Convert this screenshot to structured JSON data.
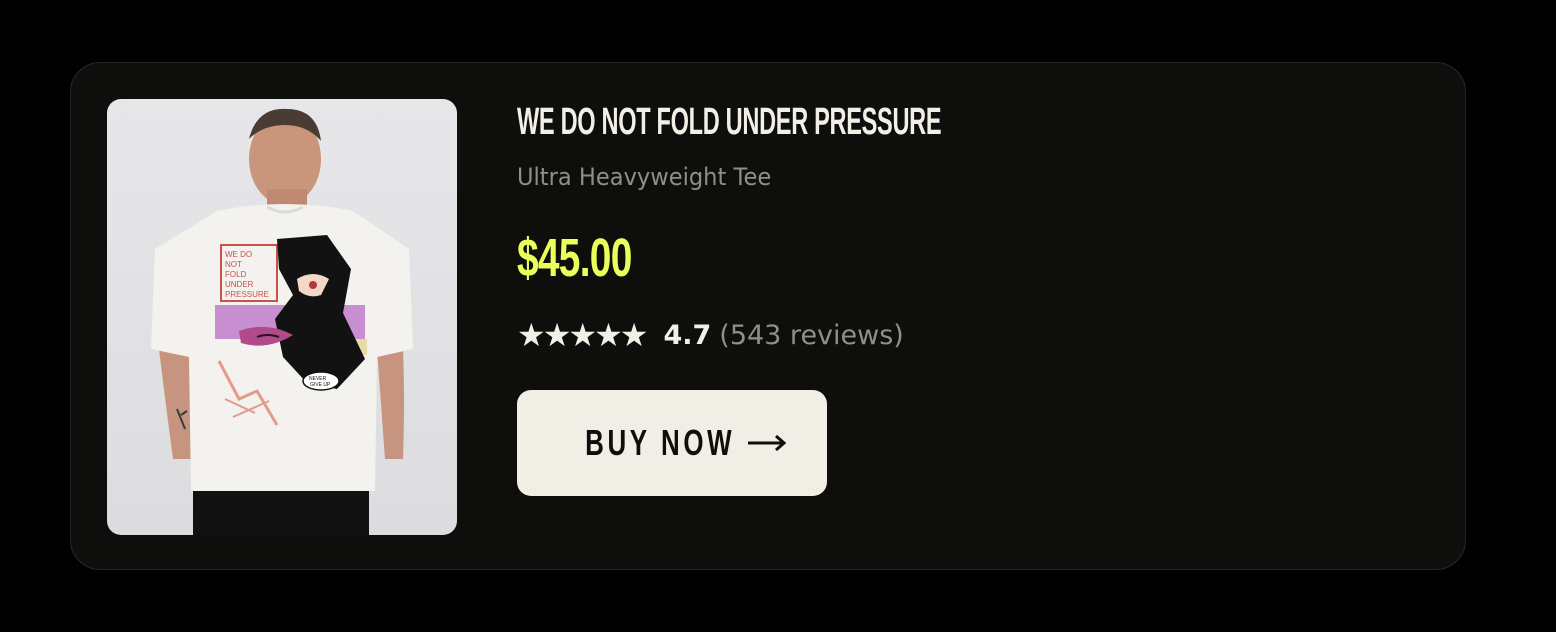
{
  "product": {
    "title": "WE DO NOT FOLD UNDER PRESSURE",
    "subtitle": "Ultra Heavyweight Tee",
    "price": "$45.00",
    "rating": {
      "stars": 5,
      "value": "4.7",
      "reviews": "(543 reviews)"
    },
    "buy_label": "BUY NOW",
    "image": {
      "icon": "tshirt-back-photo",
      "print_text": "WE DO NOT FOLD UNDER PRESSURE",
      "bubble_text": "NEVER GIVE UP"
    }
  },
  "colors": {
    "background": "#000000",
    "card": "#0e0e0c",
    "title": "#f2efe7",
    "subtitle": "#8f8e88",
    "price": "#eaff5a",
    "button": "#f1eee6"
  }
}
